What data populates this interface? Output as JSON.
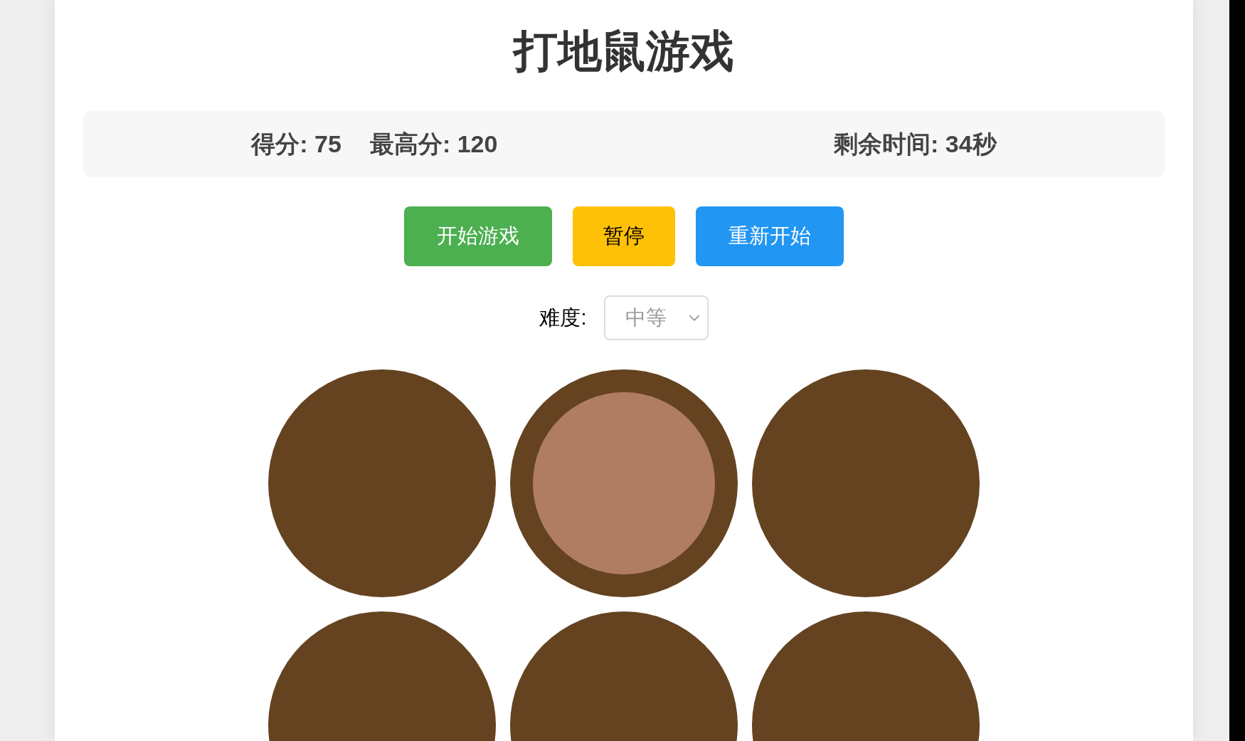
{
  "title": "打地鼠游戏",
  "stats": {
    "score": "得分: 75",
    "high_score": "最高分: 120",
    "time_left": "剩余时间: 34秒"
  },
  "buttons": [
    {
      "label": "开始游戏",
      "kind": "start"
    },
    {
      "label": "暂停",
      "kind": "pause"
    },
    {
      "label": "重新开始",
      "kind": "restart"
    }
  ],
  "difficulty": {
    "label": "难度:",
    "value": "中等",
    "disabled": true
  },
  "holes": [
    {
      "mole": false
    },
    {
      "mole": true
    },
    {
      "mole": false
    },
    {
      "mole": false
    },
    {
      "mole": false
    },
    {
      "mole": false
    }
  ]
}
